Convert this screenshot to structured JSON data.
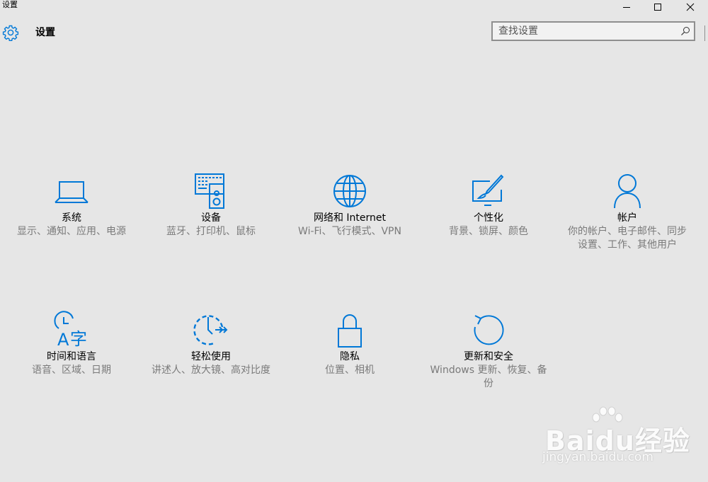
{
  "window": {
    "title": "设置"
  },
  "header": {
    "title": "设置"
  },
  "search": {
    "placeholder": "查找设置"
  },
  "colors": {
    "accent": "#0078d7",
    "background": "#e6e6e6",
    "desc_text": "#7a7a7a"
  },
  "tiles": [
    {
      "icon": "laptop-icon",
      "name": "系统",
      "desc": "显示、通知、应用、电源"
    },
    {
      "icon": "keyboard-speaker-icon",
      "name": "设备",
      "desc": "蓝牙、打印机、鼠标"
    },
    {
      "icon": "globe-icon",
      "name": "网络和 Internet",
      "desc": "Wi-Fi、飞行模式、VPN"
    },
    {
      "icon": "paint-icon",
      "name": "个性化",
      "desc": "背景、锁屏、颜色"
    },
    {
      "icon": "person-icon",
      "name": "帐户",
      "desc": "你的帐户、电子邮件、同步设置、工作、其他用户"
    },
    {
      "icon": "clock-language-icon",
      "name": "时间和语言",
      "desc": "语音、区域、日期"
    },
    {
      "icon": "ease-of-access-icon",
      "name": "轻松使用",
      "desc": "讲述人、放大镜、高对比度"
    },
    {
      "icon": "lock-icon",
      "name": "隐私",
      "desc": "位置、相机"
    },
    {
      "icon": "refresh-icon",
      "name": "更新和安全",
      "desc": "Windows 更新、恢复、备份"
    }
  ],
  "watermark": {
    "brand": "Baidu经验",
    "url": "jingyan.baidu.com"
  }
}
